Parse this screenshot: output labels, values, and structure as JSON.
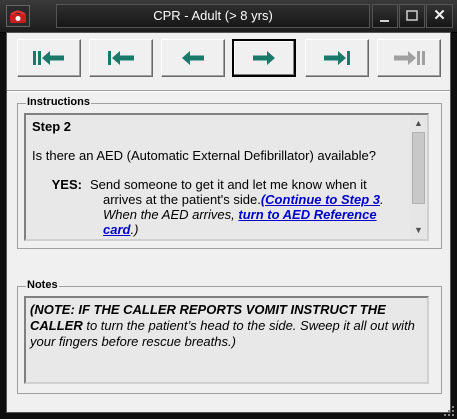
{
  "window": {
    "title": "CPR - Adult (> 8 yrs)",
    "close_glyph": "✕",
    "app_icon": "phone-icon"
  },
  "toolbar": {
    "buttons": [
      {
        "name": "first-step-button",
        "icon": "first-arrow-icon",
        "enabled": true,
        "active": false
      },
      {
        "name": "previous-section-button",
        "icon": "prev-bar-arrow-icon",
        "enabled": true,
        "active": false
      },
      {
        "name": "back-button",
        "icon": "left-arrow-icon",
        "enabled": true,
        "active": false
      },
      {
        "name": "next-button",
        "icon": "right-arrow-icon",
        "enabled": true,
        "active": true
      },
      {
        "name": "next-section-button",
        "icon": "next-bar-arrow-icon",
        "enabled": true,
        "active": false
      },
      {
        "name": "last-step-button",
        "icon": "last-arrow-icon",
        "enabled": false,
        "active": false
      }
    ],
    "accent_color": "#1a7a6a",
    "disabled_color": "#a0a0a0"
  },
  "instructions": {
    "label": "Instructions",
    "step_title": "Step 2",
    "question": "Is there an AED (Automatic External Defibrillator) available?",
    "yes_label": "YES",
    "yes_text_1": "Send someone to get it and let me know when it",
    "yes_text_2": "arrives at the patient's side.",
    "link_step3": "(Continue to Step 3",
    "after_link": ".",
    "when_text": "When the AED arrives, ",
    "link_aed_1": "turn to AED Reference",
    "link_aed_2": "card",
    "end_text": ".)",
    "link_color": "#0000cc"
  },
  "notes": {
    "label": "Notes",
    "bold_part": "(NOTE: IF THE CALLER REPORTS VOMIT INSTRUCT THE CALLER",
    "rest": " to turn the patient’s head to the side.  Sweep it all out with your fingers before rescue breaths.)"
  }
}
